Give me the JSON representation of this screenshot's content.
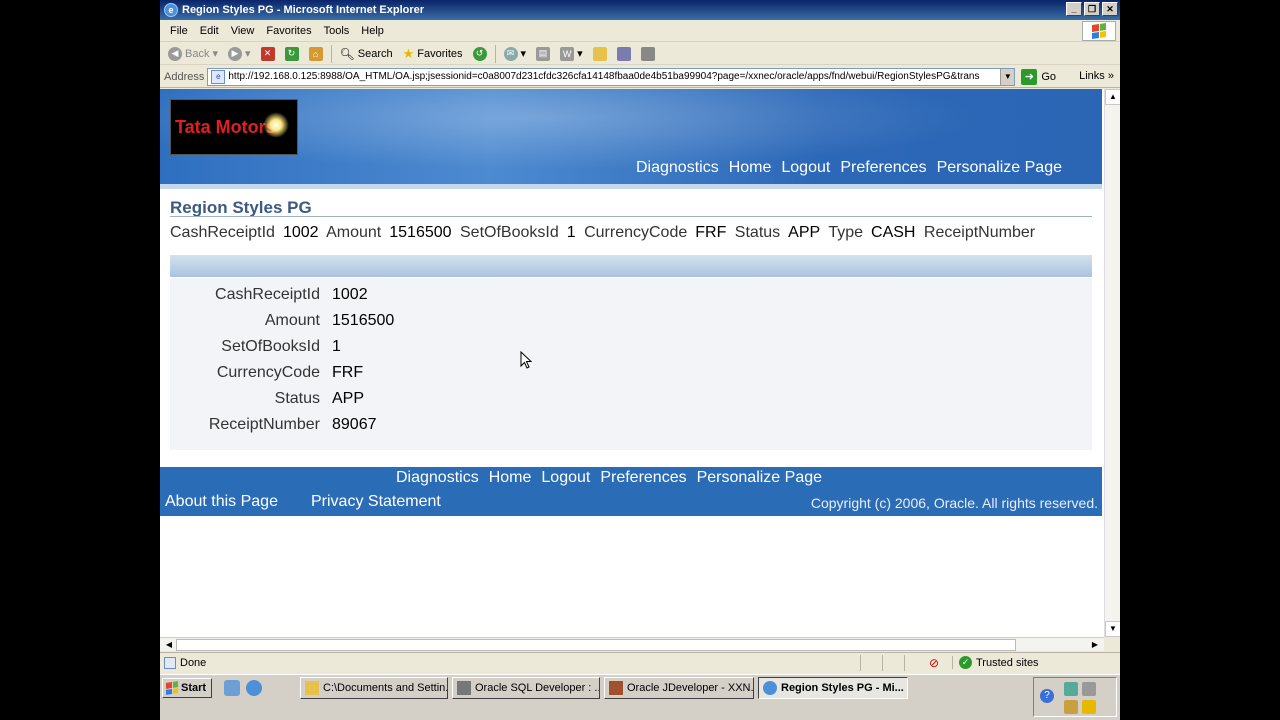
{
  "window": {
    "title": "Region Styles PG - Microsoft Internet Explorer"
  },
  "menubar": {
    "items": [
      "File",
      "Edit",
      "View",
      "Favorites",
      "Tools",
      "Help"
    ]
  },
  "toolbar": {
    "back_label": "Back",
    "search_label": "Search",
    "favorites_label": "Favorites"
  },
  "addressbar": {
    "label": "Address",
    "url": "http://192.168.0.125:8988/OA_HTML/OA.jsp;jsessionid=c0a8007d231cfdc326cfa14148fbaa0de4b51ba99904?page=/xxnec/oracle/apps/fnd/webui/RegionStylesPG&trans",
    "go_label": "Go",
    "links_label": "Links"
  },
  "header": {
    "logo_text": "Tata Motors",
    "global_nav": [
      "Diagnostics",
      "Home",
      "Logout",
      "Preferences",
      "Personalize Page"
    ]
  },
  "page": {
    "title": "Region Styles PG",
    "inline_fields": [
      {
        "label": "CashReceiptId",
        "value": "1002"
      },
      {
        "label": "Amount",
        "value": "1516500"
      },
      {
        "label": "SetOfBooksId",
        "value": "1"
      },
      {
        "label": "CurrencyCode",
        "value": "FRF"
      },
      {
        "label": "Status",
        "value": "APP"
      },
      {
        "label": "Type",
        "value": "CASH"
      },
      {
        "label": "ReceiptNumber",
        "value": ""
      }
    ],
    "fields": [
      {
        "label": "CashReceiptId",
        "value": "1002"
      },
      {
        "label": "Amount",
        "value": "1516500"
      },
      {
        "label": "SetOfBooksId",
        "value": "1"
      },
      {
        "label": "CurrencyCode",
        "value": "FRF"
      },
      {
        "label": "Status",
        "value": "APP"
      },
      {
        "label": "ReceiptNumber",
        "value": "89067"
      }
    ]
  },
  "footer": {
    "nav": [
      "Diagnostics",
      "Home",
      "Logout",
      "Preferences",
      "Personalize Page"
    ],
    "about": "About this Page",
    "privacy": "Privacy Statement",
    "copyright": "Copyright (c) 2006, Oracle. All rights reserved."
  },
  "statusbar": {
    "status": "Done",
    "zone": "Trusted sites"
  },
  "taskbar": {
    "start_label": "Start",
    "tasks": [
      {
        "label": "C:\\Documents and Settin...",
        "icon": "folder-icon",
        "active": false
      },
      {
        "label": "Oracle SQL Developer : ...",
        "icon": "sql-developer-icon",
        "active": false
      },
      {
        "label": "Oracle JDeveloper - XXN...",
        "icon": "jdeveloper-icon",
        "active": false
      },
      {
        "label": "Region Styles PG - Mi...",
        "icon": "ie-icon",
        "active": true
      }
    ]
  },
  "colors": {
    "header_blue": "#2f6fc0",
    "footer_blue": "#2b6cb7",
    "title_text": "#3c5a82",
    "logo_red": "#e02020"
  }
}
